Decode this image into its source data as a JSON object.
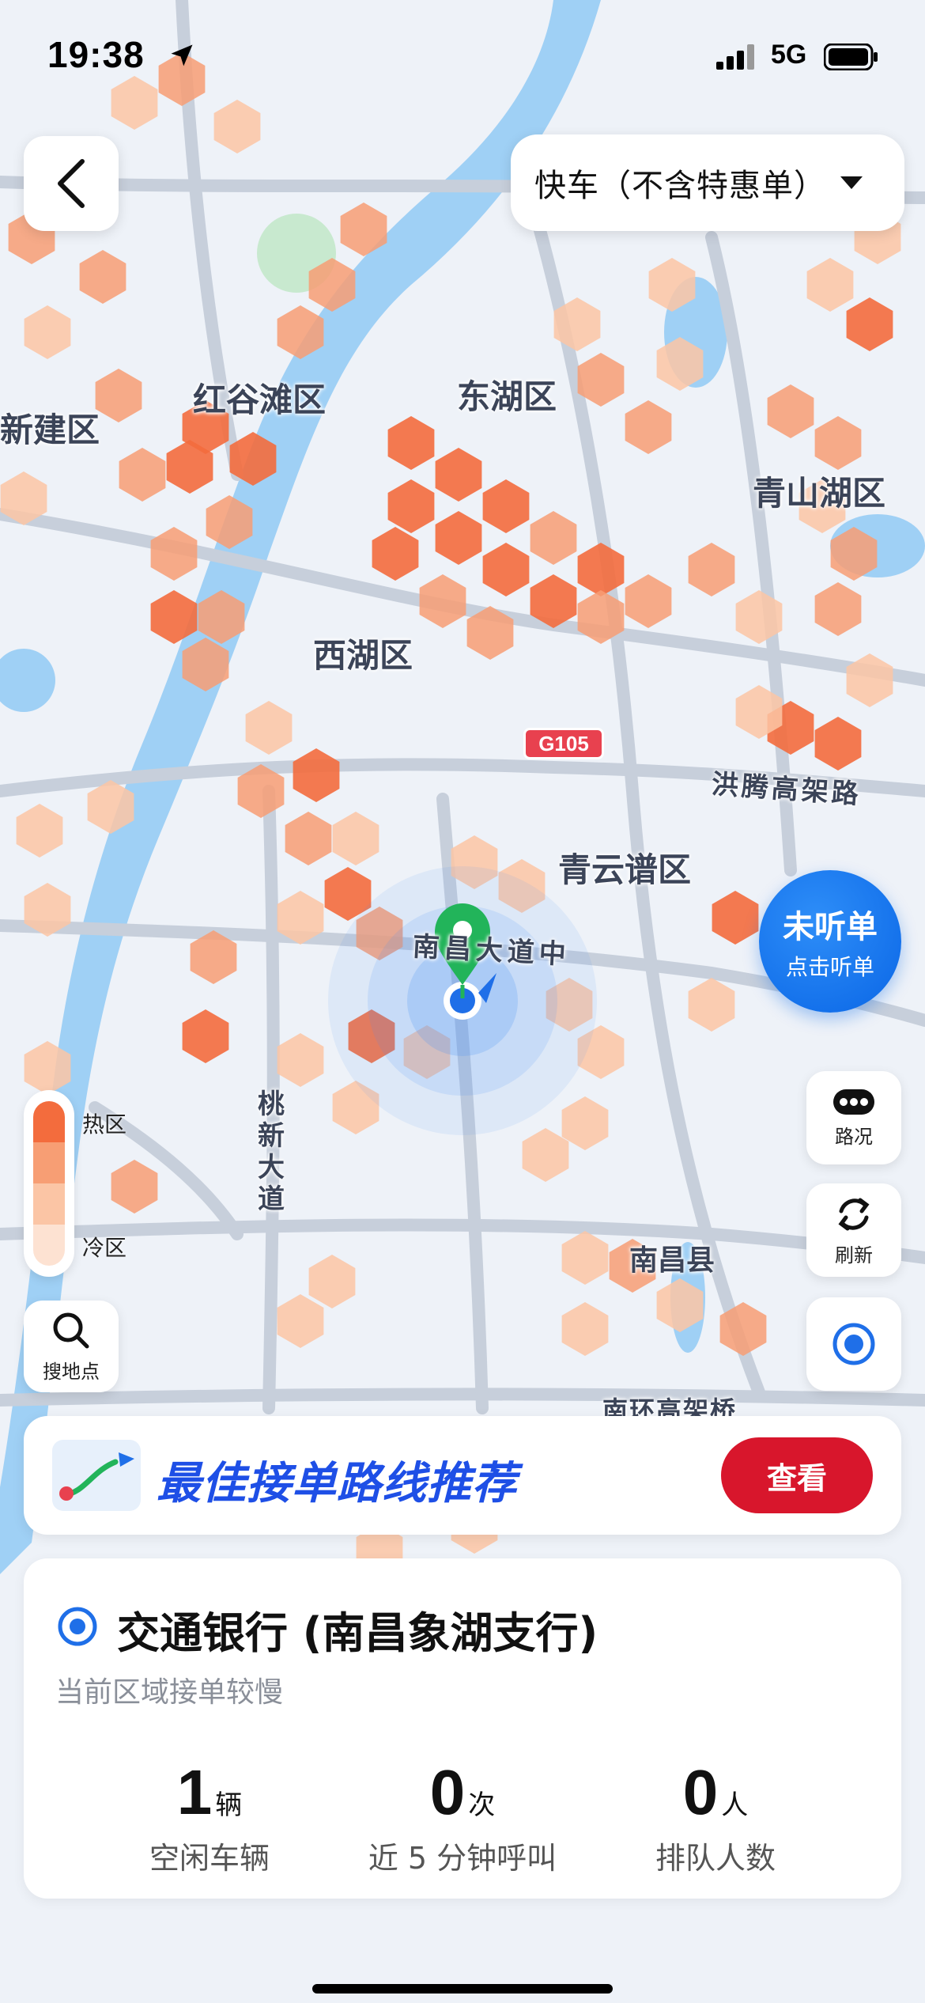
{
  "status_bar": {
    "time": "19:38",
    "network": "5G"
  },
  "header": {
    "mode_label": "快车（不含特惠单）"
  },
  "map": {
    "districts": [
      "红谷滩区",
      "东湖区",
      "新建区",
      "青山湖区",
      "西湖区",
      "青云谱区",
      "南昌县"
    ],
    "roads": [
      "洪腾高架路",
      "南昌大道中",
      "桃新大道",
      "南环高架桥"
    ],
    "road_badge": "G105",
    "colors": {
      "hot": "#f36c3d",
      "warm": "#f79e74",
      "mild": "#fbc5a5",
      "cool": "#fde2d2",
      "water": "#9fd0f5"
    }
  },
  "legend": {
    "hot_label": "热区",
    "cold_label": "冷区"
  },
  "controls": {
    "search_label": "搜地点",
    "traffic_label": "路况",
    "refresh_label": "刷新",
    "listen_title": "未听单",
    "listen_sub": "点击听单"
  },
  "route_card": {
    "title": "最佳接单路线推荐",
    "button": "查看"
  },
  "info_card": {
    "place": "交通银行 (南昌象湖支行)",
    "subtitle": "当前区域接单较慢",
    "stats": [
      {
        "value": "1",
        "unit": "辆",
        "label": "空闲车辆"
      },
      {
        "value": "0",
        "unit": "次",
        "label": "近 5 分钟呼叫"
      },
      {
        "value": "0",
        "unit": "人",
        "label": "排队人数"
      }
    ]
  }
}
